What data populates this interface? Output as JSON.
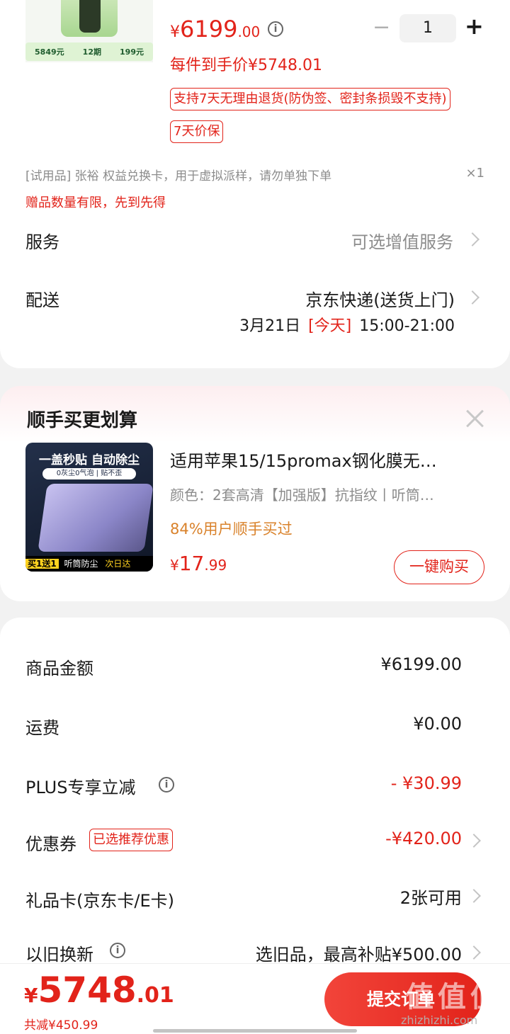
{
  "product": {
    "promo_strip": [
      "5849元",
      "12期",
      "199元"
    ],
    "price_symbol": "¥",
    "price_int": "6199",
    "price_dec": ".00",
    "qty_value": "1",
    "qty_minus": "−",
    "qty_plus": "+",
    "final_price": "每件到手价¥5748.01",
    "tag_return": "支持7天无理由退货(防伪签、密封条损毁不支持)",
    "tag_price_protect": "7天价保"
  },
  "gift": {
    "text": "[试用品]  张裕 权益兑换卡，用于虚拟派样，请勿单独下单",
    "count": "×1",
    "notice": "赠品数量有限，先到先得"
  },
  "service": {
    "label": "服务",
    "value": "可选增值服务"
  },
  "delivery": {
    "label": "配送",
    "method": "京东快递(送货上门)",
    "date": "3月21日",
    "today": "[今天]",
    "time": "15:00-21:00"
  },
  "upsell": {
    "title": "顺手买更划算",
    "img_banner": "一盖秒贴 自动除尘",
    "img_sub": "0灰尘0气泡 | 贴不歪",
    "img_footer_badge": "买1送1",
    "img_footer_text": "听筒防尘",
    "img_footer_brand": "次日达",
    "name": "适用苹果15/15promax钢化膜无…",
    "spec": "颜色：2套高清【加强版】抗指纹丨听筒…",
    "stat": "84%用户顺手买过",
    "price_symbol": "¥",
    "price_int": "17",
    "price_dec": ".99",
    "buy_button": "一键购买"
  },
  "summary": {
    "goods_label": "商品金额",
    "goods_value": "¥6199.00",
    "shipping_label": "运费",
    "shipping_value": "¥0.00",
    "plus_label": "PLUS专享立减",
    "plus_value": "- ¥30.99",
    "coupon_label": "优惠券",
    "coupon_tag": "已选推荐优惠",
    "coupon_value": "-¥420.00",
    "giftcard_label": "礼品卡(京东卡/E卡)",
    "giftcard_value": "2张可用",
    "tradein_label": "以旧换新",
    "tradein_value": "选旧品，最高补贴¥500.00"
  },
  "footer": {
    "total_symbol": "¥",
    "total_int": "5748",
    "total_dec": ".01",
    "saved": "共减¥450.99",
    "submit": "提交订单",
    "watermark": "值 值 值",
    "watermark_url": "zhizhizhi.com"
  },
  "colors": {
    "accent": "#e2231a",
    "orange": "#d9822b",
    "background": "#f2f2f2"
  },
  "icons": [
    "info-icon",
    "close-icon",
    "chevron-right-icon",
    "minus-icon",
    "plus-icon"
  ]
}
